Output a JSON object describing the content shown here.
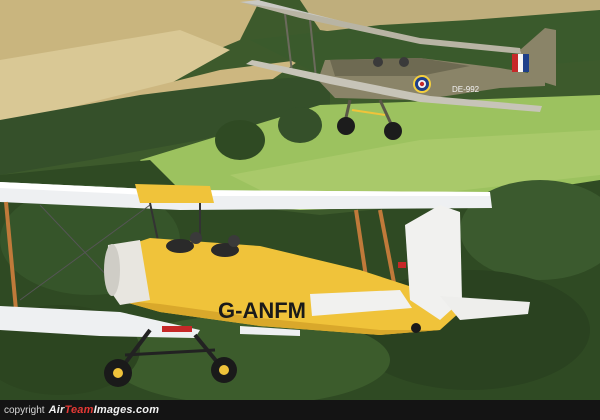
{
  "footer": {
    "copyright": "copyright",
    "brand_air": "Air",
    "brand_team": "Team",
    "brand_images": "Images",
    "brand_domain": ".com"
  },
  "aircraft": {
    "front": {
      "registration": "G-ANFM",
      "color": "#f0c33a"
    },
    "rear": {
      "registration": "DE-992",
      "color": "#8a8468"
    }
  },
  "colors": {
    "sky_field": "#a9c96a",
    "forest": "#2f4a23",
    "crop_field": "#d8c38e",
    "footer_bg": "#141414",
    "brand_red": "#e53935"
  }
}
